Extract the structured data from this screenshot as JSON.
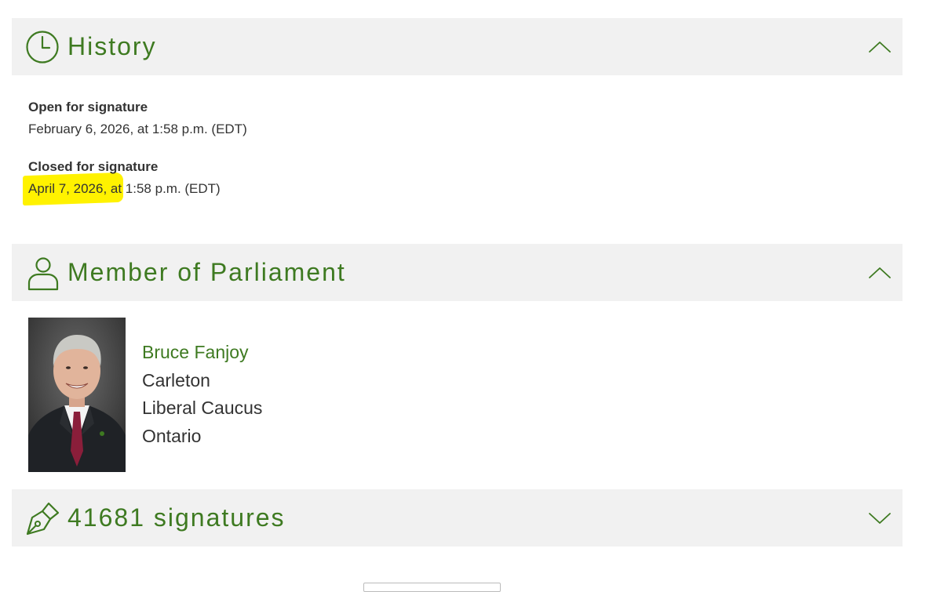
{
  "history": {
    "title": "History",
    "open_label": "Open for signature",
    "open_value": "February 6, 2026, at 1:58 p.m. (EDT)",
    "closed_label": "Closed for signature",
    "closed_value": "April 7, 2026, at 1:58 p.m. (EDT)",
    "icon": "clock-icon",
    "expanded": true
  },
  "member": {
    "title": "Member of Parliament",
    "icon": "person-icon",
    "expanded": true,
    "name": "Bruce Fanjoy",
    "riding": "Carleton",
    "caucus": "Liberal Caucus",
    "province": "Ontario"
  },
  "signatures": {
    "title": "41681 signatures",
    "icon": "fountain-pen-icon",
    "expanded": false
  },
  "colors": {
    "accent": "#3e7a21",
    "header_bg": "#f1f1f1",
    "highlight": "#fff200",
    "text": "#333333"
  }
}
